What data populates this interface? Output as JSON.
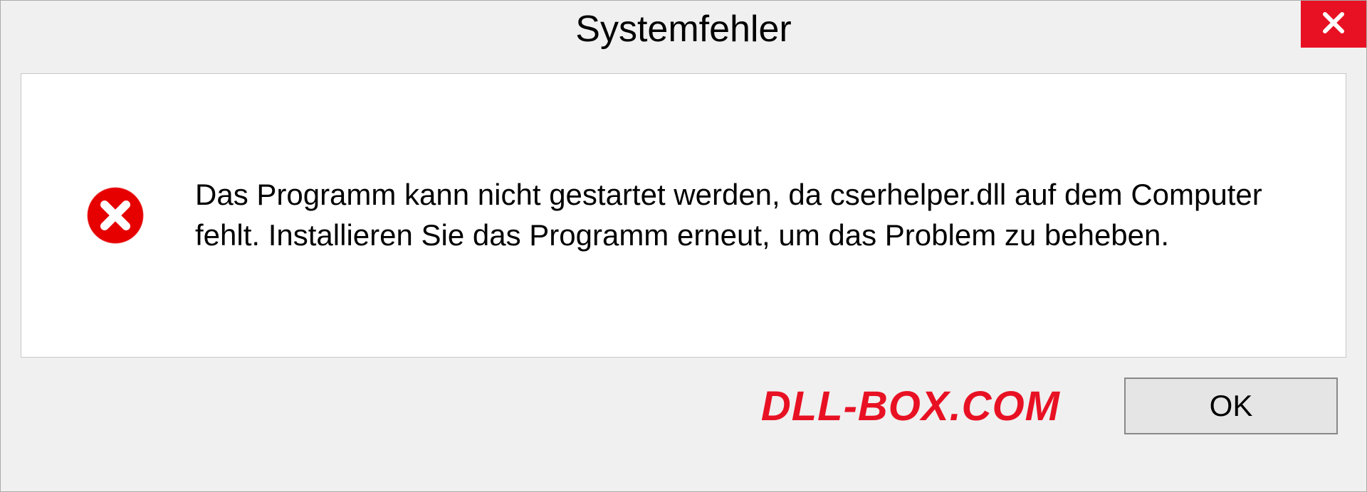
{
  "dialog": {
    "title": "Systemfehler",
    "message": "Das Programm kann nicht gestartet werden, da cserhelper.dll auf dem Computer fehlt. Installieren Sie das Programm erneut, um das Problem zu beheben.",
    "ok_label": "OK",
    "watermark": "DLL-BOX.COM"
  },
  "colors": {
    "error_red": "#e81123",
    "panel_bg": "#f0f0f0"
  }
}
